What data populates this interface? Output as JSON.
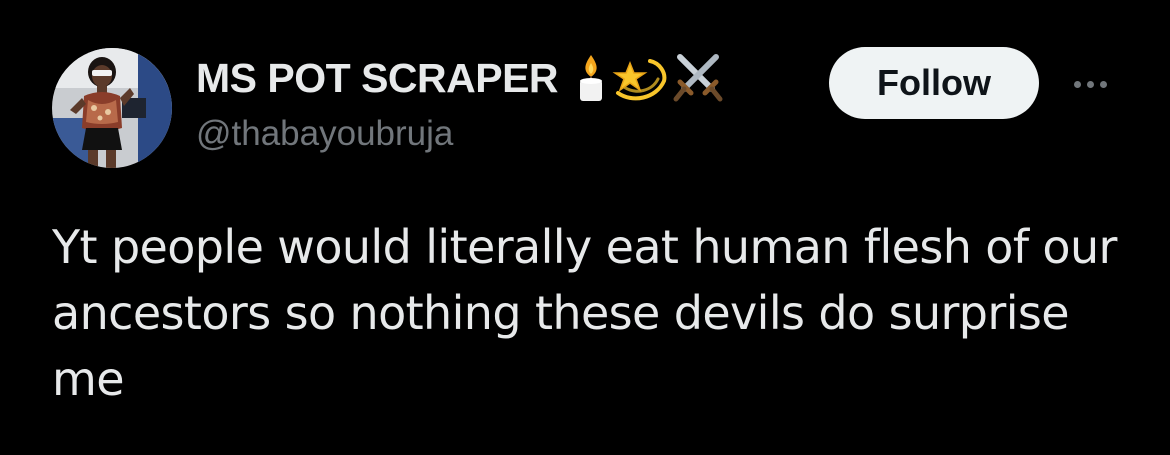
{
  "tweet": {
    "author": {
      "display_name": "MS POT SCRAPER",
      "handle": "@thabayoubruja",
      "avatar_icon": "profile-photo",
      "name_emojis": [
        "candle-icon",
        "dizzy-star-icon",
        "crossed-swords-icon"
      ]
    },
    "follow_label": "Follow",
    "more_icon": "more-options-icon",
    "text": "Yt people would literally eat human flesh of our ancestors so nothing these devils do surprise me"
  },
  "colors": {
    "background": "#000000",
    "primary_text": "#e7e9ea",
    "secondary_text": "#71767b",
    "follow_bg": "#eff3f4",
    "follow_text": "#0f1419"
  }
}
